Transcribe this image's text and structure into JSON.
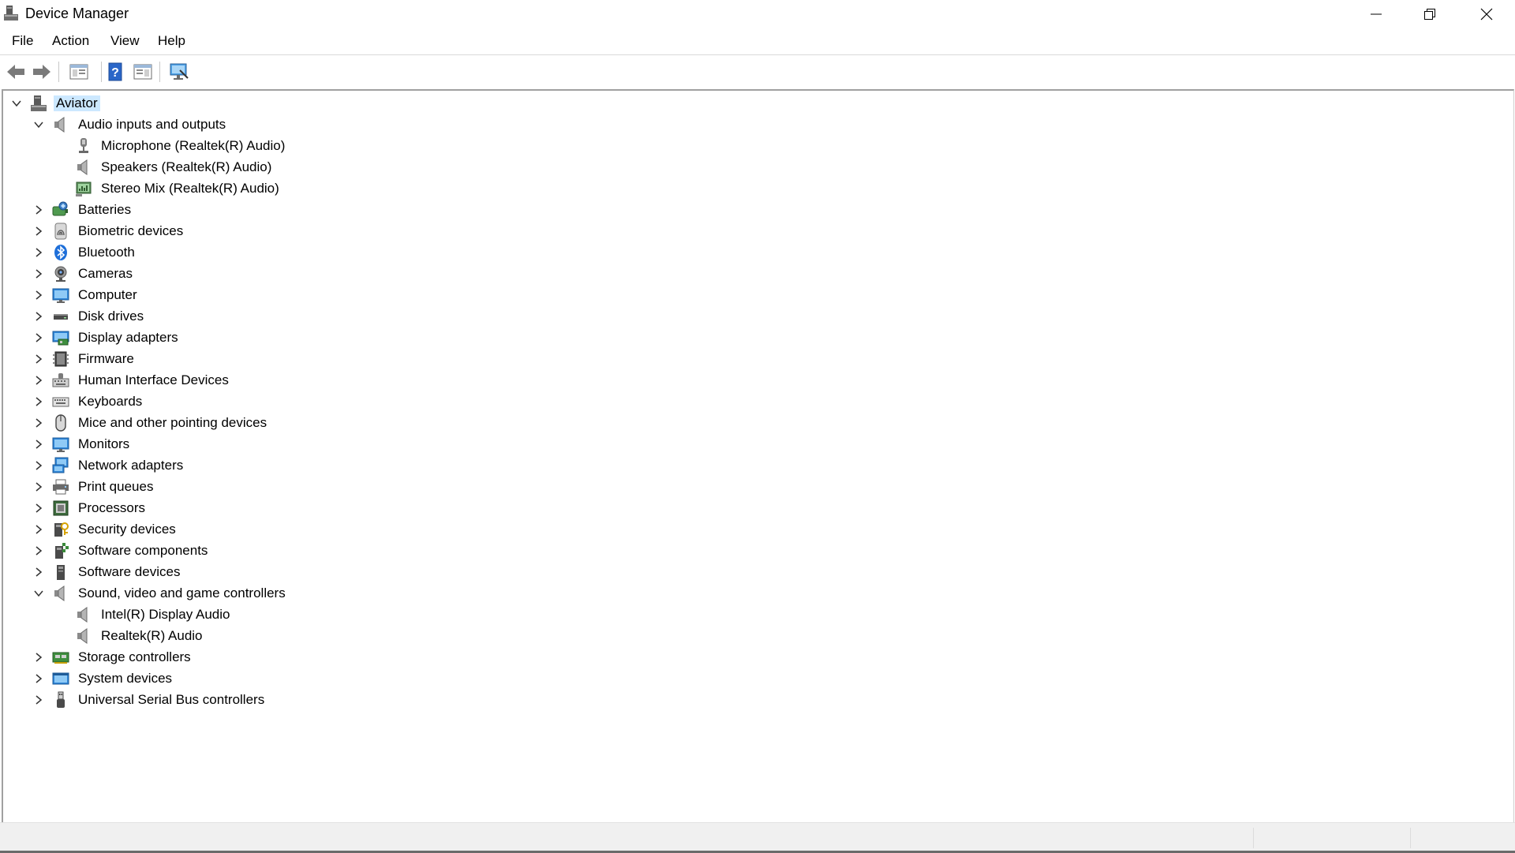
{
  "window": {
    "title": "Device Manager",
    "controls": [
      "minimize",
      "restore",
      "close"
    ]
  },
  "menu": [
    "File",
    "Action",
    "View",
    "Help"
  ],
  "toolbar": {
    "buttons": [
      "back-arrow-icon",
      "forward-arrow-icon",
      "properties-console-icon",
      "help-icon",
      "show-hide-pane-icon",
      "monitor-scan-icon"
    ]
  },
  "tree": {
    "root": "Aviator",
    "items": [
      {
        "label": "Audio inputs and outputs",
        "icon": "speaker-icon",
        "expanded": true,
        "children": [
          "Microphone (Realtek(R) Audio)",
          "Speakers (Realtek(R) Audio)",
          "Stereo Mix (Realtek(R) Audio)"
        ]
      },
      {
        "label": "Batteries",
        "icon": "battery-icon",
        "expanded": false
      },
      {
        "label": "Biometric devices",
        "icon": "fingerprint-icon",
        "expanded": false
      },
      {
        "label": "Bluetooth",
        "icon": "bluetooth-icon",
        "expanded": false
      },
      {
        "label": "Cameras",
        "icon": "camera-icon",
        "expanded": false
      },
      {
        "label": "Computer",
        "icon": "computer-icon",
        "expanded": false
      },
      {
        "label": "Disk drives",
        "icon": "disk-drive-icon",
        "expanded": false
      },
      {
        "label": "Display adapters",
        "icon": "display-adapter-icon",
        "expanded": false
      },
      {
        "label": "Firmware",
        "icon": "firmware-icon",
        "expanded": false
      },
      {
        "label": "Human Interface Devices",
        "icon": "hid-icon",
        "expanded": false
      },
      {
        "label": "Keyboards",
        "icon": "keyboard-icon",
        "expanded": false
      },
      {
        "label": "Mice and other pointing devices",
        "icon": "mouse-icon",
        "expanded": false
      },
      {
        "label": "Monitors",
        "icon": "monitor-icon",
        "expanded": false
      },
      {
        "label": "Network adapters",
        "icon": "network-adapter-icon",
        "expanded": false
      },
      {
        "label": "Print queues",
        "icon": "printer-icon",
        "expanded": false
      },
      {
        "label": "Processors",
        "icon": "processor-icon",
        "expanded": false
      },
      {
        "label": "Security devices",
        "icon": "security-device-icon",
        "expanded": false
      },
      {
        "label": "Software components",
        "icon": "software-component-icon",
        "expanded": false
      },
      {
        "label": "Software devices",
        "icon": "software-device-icon",
        "expanded": false
      },
      {
        "label": "Sound, video and game controllers",
        "icon": "speaker-icon",
        "expanded": true,
        "children": [
          "Intel(R) Display Audio",
          "Realtek(R) Audio"
        ]
      },
      {
        "label": "Storage controllers",
        "icon": "storage-controller-icon",
        "expanded": false
      },
      {
        "label": "System devices",
        "icon": "system-device-icon",
        "expanded": false
      },
      {
        "label": "Universal Serial Bus controllers",
        "icon": "usb-icon",
        "expanded": false
      }
    ]
  },
  "colors": {
    "selection": "#cce8ff",
    "accent": "#1e6fd9"
  }
}
